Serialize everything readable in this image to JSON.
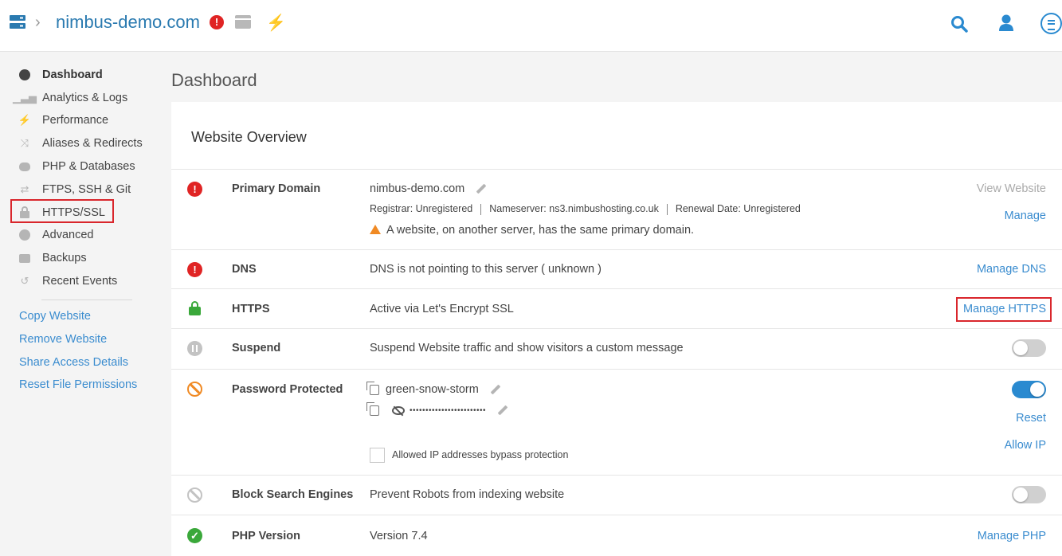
{
  "header": {
    "site_title": "nimbus-demo.com",
    "alert_badge": "!",
    "chevron": "›",
    "icons": [
      "server-icon",
      "alert-icon",
      "card-icon",
      "bolt-icon",
      "search-icon",
      "user-icon",
      "menu-icon"
    ]
  },
  "sidebar": {
    "items": [
      {
        "label": "Dashboard",
        "icon": "gauge-icon",
        "active": true
      },
      {
        "label": "Analytics & Logs",
        "icon": "chart-icon"
      },
      {
        "label": "Performance",
        "icon": "bolt-icon"
      },
      {
        "label": "Aliases & Redirects",
        "icon": "shuffle-icon"
      },
      {
        "label": "PHP & Databases",
        "icon": "database-icon"
      },
      {
        "label": "FTPS, SSH & Git",
        "icon": "transfer-icon"
      },
      {
        "label": "HTTPS/SSL",
        "icon": "lock-icon",
        "highlighted": true
      },
      {
        "label": "Advanced",
        "icon": "advanced-icon"
      },
      {
        "label": "Backups",
        "icon": "camera-icon"
      },
      {
        "label": "Recent Events",
        "icon": "history-icon"
      }
    ],
    "links": [
      "Copy Website",
      "Remove Website",
      "Share Access Details",
      "Reset File Permissions"
    ]
  },
  "main": {
    "heading": "Dashboard",
    "panel_title": "Website Overview",
    "rows": {
      "primary_domain": {
        "label": "Primary Domain",
        "value": "nimbus-demo.com",
        "registrar": "Registrar: Unregistered",
        "nameserver": "Nameserver: ns3.nimbushosting.co.uk",
        "renewal": "Renewal Date: Unregistered",
        "warning": "A website, on another server, has the same primary domain.",
        "action_view": "View Website",
        "action_manage": "Manage",
        "status": "error"
      },
      "dns": {
        "label": "DNS",
        "value": "DNS is not pointing to this server ( unknown )",
        "action": "Manage DNS",
        "status": "error"
      },
      "https": {
        "label": "HTTPS",
        "value": "Active via Let's Encrypt SSL",
        "action": "Manage HTTPS",
        "status": "secure"
      },
      "suspend": {
        "label": "Suspend",
        "value": "Suspend Website traffic and show visitors a custom message",
        "toggle_on": false
      },
      "password": {
        "label": "Password Protected",
        "username": "green-snow-storm",
        "password_masked": "••••••••••••••••••••••••",
        "toggle_on": true,
        "action_reset": "Reset",
        "action_allow_ip": "Allow IP",
        "checkbox_label": "Allowed IP addresses bypass protection",
        "checkbox_checked": false
      },
      "block_search": {
        "label": "Block Search Engines",
        "value": "Prevent Robots from indexing website",
        "toggle_on": false
      },
      "php": {
        "label": "PHP Version",
        "value": "Version 7.4",
        "action": "Manage PHP",
        "status": "ok"
      }
    }
  },
  "colors": {
    "accent": "#2a8ad0",
    "link": "#3a8ccf",
    "error": "#e02424",
    "success": "#3aa83a",
    "warning": "#f08a24",
    "highlight": "#d9262c"
  }
}
